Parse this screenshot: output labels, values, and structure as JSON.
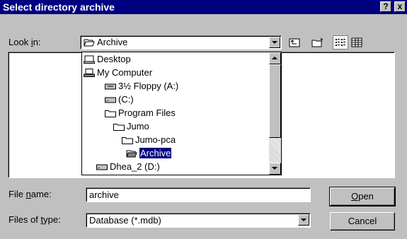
{
  "window": {
    "title": "Select directory archive",
    "help_label": "?",
    "close_label": "x"
  },
  "look_in": {
    "label_pre": "Look ",
    "label_key": "i",
    "label_post": "n:",
    "value": "Archive"
  },
  "tree_items": [
    {
      "label": "Desktop",
      "icon": "desktop-icon"
    },
    {
      "label": "My Computer",
      "icon": "computer-icon"
    },
    {
      "label": "3½ Floppy (A:)",
      "icon": "floppy-drive-icon"
    },
    {
      "label": "(C:)",
      "icon": "hard-drive-icon"
    },
    {
      "label": "Program Files",
      "icon": "folder-icon"
    },
    {
      "label": "Jumo",
      "icon": "folder-icon"
    },
    {
      "label": "Jumo-pca",
      "icon": "folder-icon"
    },
    {
      "label": "Archive",
      "icon": "open-folder-icon",
      "selected": true
    },
    {
      "label": "Dhea_2 (D:)",
      "icon": "hard-drive-icon"
    }
  ],
  "toolbar": {
    "up_folder": "up-one-level-icon",
    "new_folder": "new-folder-icon",
    "list_view": "list-view-icon",
    "details_view": "details-view-icon"
  },
  "file_name": {
    "label_pre": "File ",
    "label_key": "n",
    "label_post": "ame:",
    "value": "archive"
  },
  "file_type": {
    "label_pre": "Files of ",
    "label_key": "t",
    "label_post": "ype:",
    "value": "Database (*.mdb)"
  },
  "buttons": {
    "open_key": "O",
    "open_rest": "pen",
    "cancel": "Cancel"
  },
  "colors": {
    "titlebar": "#000080",
    "selection": "#000080",
    "face": "#c0c0c0"
  }
}
